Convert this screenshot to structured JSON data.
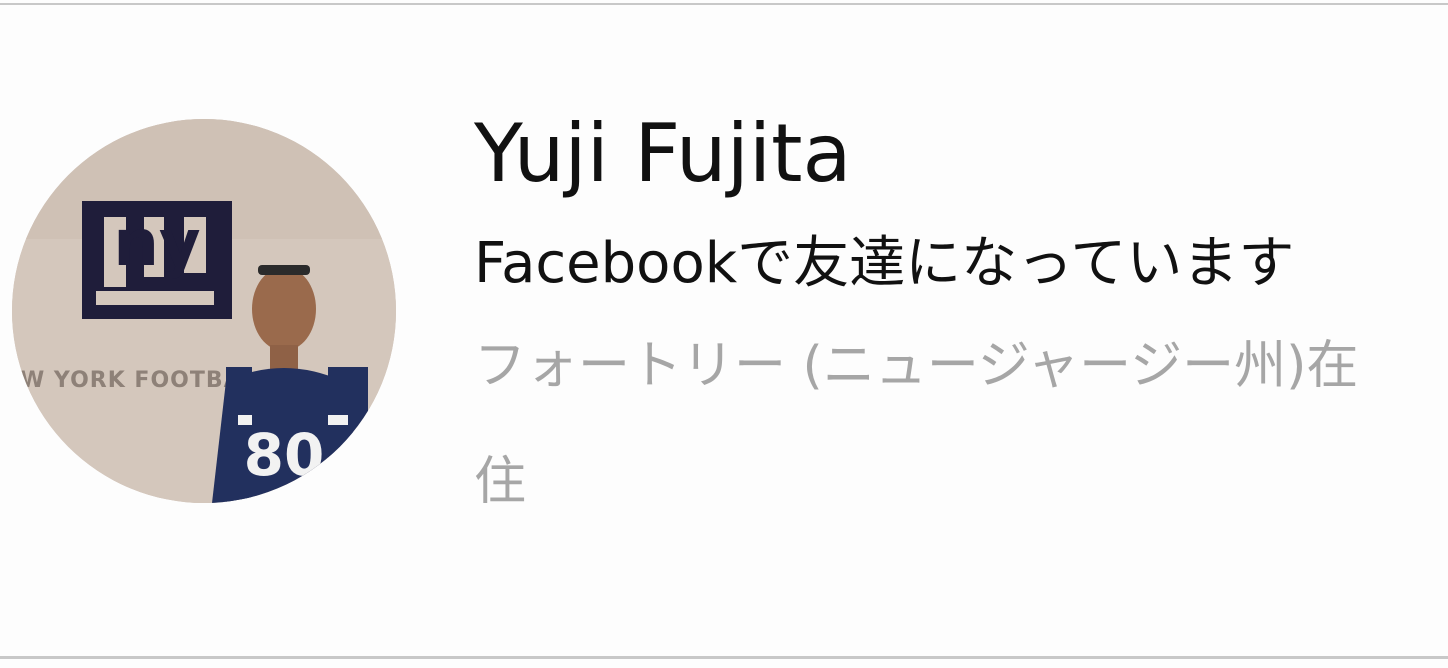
{
  "profile": {
    "name": "Yuji Fujita",
    "relation": "Facebookで友達になっています",
    "location": "フォートリー (ニュージャージー州)在住"
  },
  "avatar": {
    "icon": "profile-photo",
    "photo_logo_text": "ny",
    "photo_wall_text": "W YORK FOOTBALL",
    "jersey_number": "80"
  }
}
